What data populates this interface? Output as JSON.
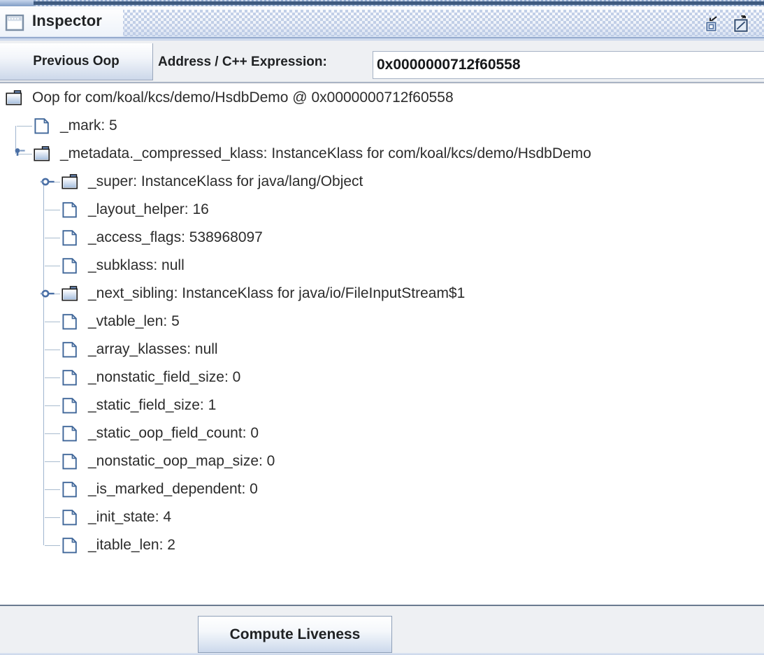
{
  "window": {
    "title": "Inspector",
    "icon": "internal-frame-icon",
    "restore_icon": "restore-window-icon",
    "maximize_icon": "maximize-window-icon"
  },
  "toolbar": {
    "previous_oop_label": "Previous Oop",
    "address_label": "Address / C++ Expression:",
    "address_value": "0x0000000712f60558",
    "address_placeholder": "Address / C++ Expression"
  },
  "tree": {
    "rows": [
      {
        "label": "Oop for com/koal/kcs/demo/HsdbDemo @ 0x0000000712f60558",
        "icon": "folder-icon",
        "depth": 0,
        "handle": "none"
      },
      {
        "label": "_mark: 5",
        "icon": "document-icon",
        "depth": 1,
        "handle": "leaf"
      },
      {
        "label": "_metadata._compressed_klass: InstanceKlass for com/koal/kcs/demo/HsdbDemo",
        "icon": "folder-icon",
        "depth": 1,
        "handle": "expanded"
      },
      {
        "label": "_super: InstanceKlass for java/lang/Object",
        "icon": "folder-icon",
        "depth": 2,
        "handle": "collapsed"
      },
      {
        "label": "_layout_helper: 16",
        "icon": "document-icon",
        "depth": 2,
        "handle": "leaf"
      },
      {
        "label": "_access_flags: 538968097",
        "icon": "document-icon",
        "depth": 2,
        "handle": "leaf"
      },
      {
        "label": "_subklass: null",
        "icon": "document-icon",
        "depth": 2,
        "handle": "leaf"
      },
      {
        "label": "_next_sibling: InstanceKlass for java/io/FileInputStream$1",
        "icon": "folder-icon",
        "depth": 2,
        "handle": "collapsed"
      },
      {
        "label": "_vtable_len: 5",
        "icon": "document-icon",
        "depth": 2,
        "handle": "leaf"
      },
      {
        "label": "_array_klasses: null",
        "icon": "document-icon",
        "depth": 2,
        "handle": "leaf"
      },
      {
        "label": "_nonstatic_field_size: 0",
        "icon": "document-icon",
        "depth": 2,
        "handle": "leaf"
      },
      {
        "label": "_static_field_size: 1",
        "icon": "document-icon",
        "depth": 2,
        "handle": "leaf"
      },
      {
        "label": "_static_oop_field_count: 0",
        "icon": "document-icon",
        "depth": 2,
        "handle": "leaf"
      },
      {
        "label": "_nonstatic_oop_map_size: 0",
        "icon": "document-icon",
        "depth": 2,
        "handle": "leaf"
      },
      {
        "label": "_is_marked_dependent: 0",
        "icon": "document-icon",
        "depth": 2,
        "handle": "leaf"
      },
      {
        "label": "_init_state: 4",
        "icon": "document-icon",
        "depth": 2,
        "handle": "leaf"
      },
      {
        "label": "_itable_len: 2",
        "icon": "document-icon",
        "depth": 2,
        "handle": "leaf"
      }
    ]
  },
  "footer": {
    "compute_liveness_label": "Compute Liveness"
  },
  "colors": {
    "titlebar_accent": "#93a9cd",
    "tree_line": "#9fb4cf",
    "icon_blue": "#4a6fa5",
    "text": "#2c2c2c"
  }
}
